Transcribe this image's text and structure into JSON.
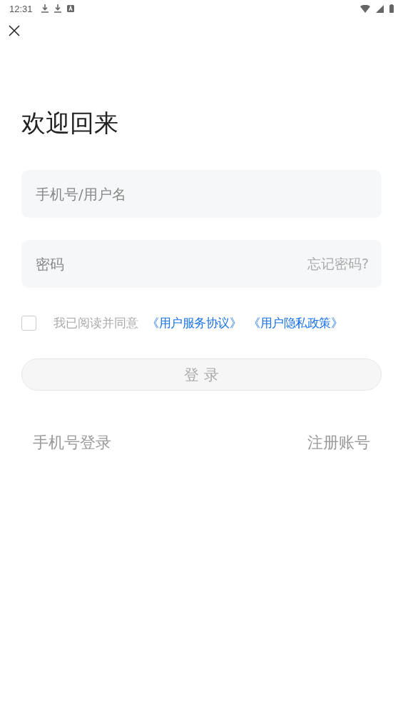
{
  "status_bar": {
    "time": "12:31"
  },
  "title": "欢迎回来",
  "username_field": {
    "placeholder": "手机号/用户名"
  },
  "password_field": {
    "placeholder": "密码",
    "forgot_link": "忘记密码?"
  },
  "agreement": {
    "checked": false,
    "text": "我已阅读并同意",
    "links": [
      "《用户服务协议》",
      "《用户隐私政策》"
    ]
  },
  "login_button": {
    "label": "登 录",
    "disabled": true
  },
  "bottom_links": [
    "手机号登录",
    "注册账号"
  ]
}
